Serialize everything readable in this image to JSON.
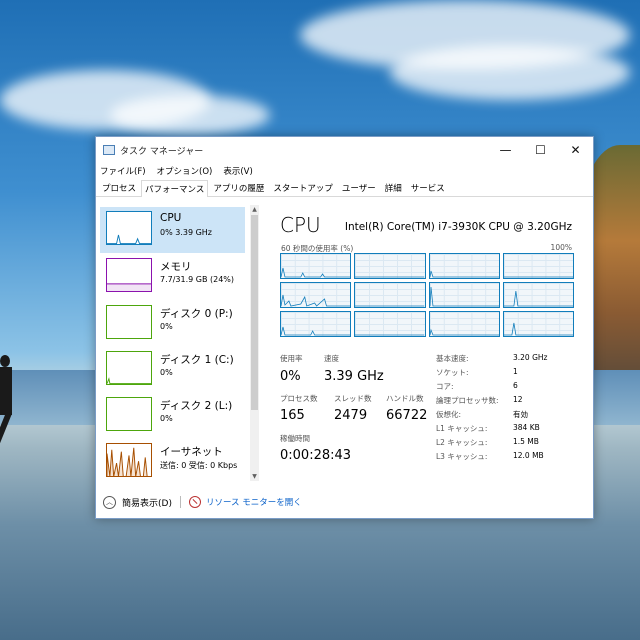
{
  "window": {
    "title": "タスク マネージャー",
    "controls": {
      "minimize": "—",
      "maximize": "☐",
      "close": "✕"
    }
  },
  "menu": [
    "ファイル(F)",
    "オプション(O)",
    "表示(V)"
  ],
  "tabs": [
    "プロセス",
    "パフォーマンス",
    "アプリの履歴",
    "スタートアップ",
    "ユーザー",
    "詳細",
    "サービス"
  ],
  "active_tab": "パフォーマンス",
  "sidebar": {
    "items": [
      {
        "name": "CPU",
        "detail": "0%  3.39 GHz",
        "color": "#117dbb"
      },
      {
        "name": "メモリ",
        "detail": "7.7/31.9 GB (24%)",
        "color": "#8b12ae"
      },
      {
        "name": "ディスク 0 (P:)",
        "detail": "0%",
        "color": "#4da60c"
      },
      {
        "name": "ディスク 1 (C:)",
        "detail": "0%",
        "color": "#4da60c"
      },
      {
        "name": "ディスク 2 (L:)",
        "detail": "0%",
        "color": "#4da60c"
      },
      {
        "name": "イーサネット",
        "detail": "送信: 0 受信: 0 Kbps",
        "color": "#a74f01"
      }
    ]
  },
  "main": {
    "title": "CPU",
    "model": "Intel(R) Core(TM) i7-3930K CPU @ 3.20GHz",
    "graph_label": "60 秒間の使用率 (%)",
    "graph_max": "100%",
    "usage_label": "使用率",
    "usage_value": "0%",
    "speed_label": "速度",
    "speed_value": "3.39 GHz",
    "processes_label": "プロセス数",
    "processes_value": "165",
    "threads_label": "スレッド数",
    "threads_value": "2479",
    "handles_label": "ハンドル数",
    "handles_value": "66722",
    "uptime_label": "稼働時間",
    "uptime_value": "0:00:28:43",
    "specs": [
      {
        "key": "基本速度:",
        "value": "3.20 GHz"
      },
      {
        "key": "ソケット:",
        "value": "1"
      },
      {
        "key": "コア:",
        "value": "6"
      },
      {
        "key": "論理プロセッサ数:",
        "value": "12"
      },
      {
        "key": "仮想化:",
        "value": "有効"
      },
      {
        "key": "L1 キャッシュ:",
        "value": "384 KB"
      },
      {
        "key": "L2 キャッシュ:",
        "value": "1.5 MB"
      },
      {
        "key": "L3 キャッシュ:",
        "value": "12.0 MB"
      }
    ]
  },
  "footer": {
    "fewer_details": "簡易表示(D)",
    "resource_monitor": "リソース モニターを開く"
  }
}
